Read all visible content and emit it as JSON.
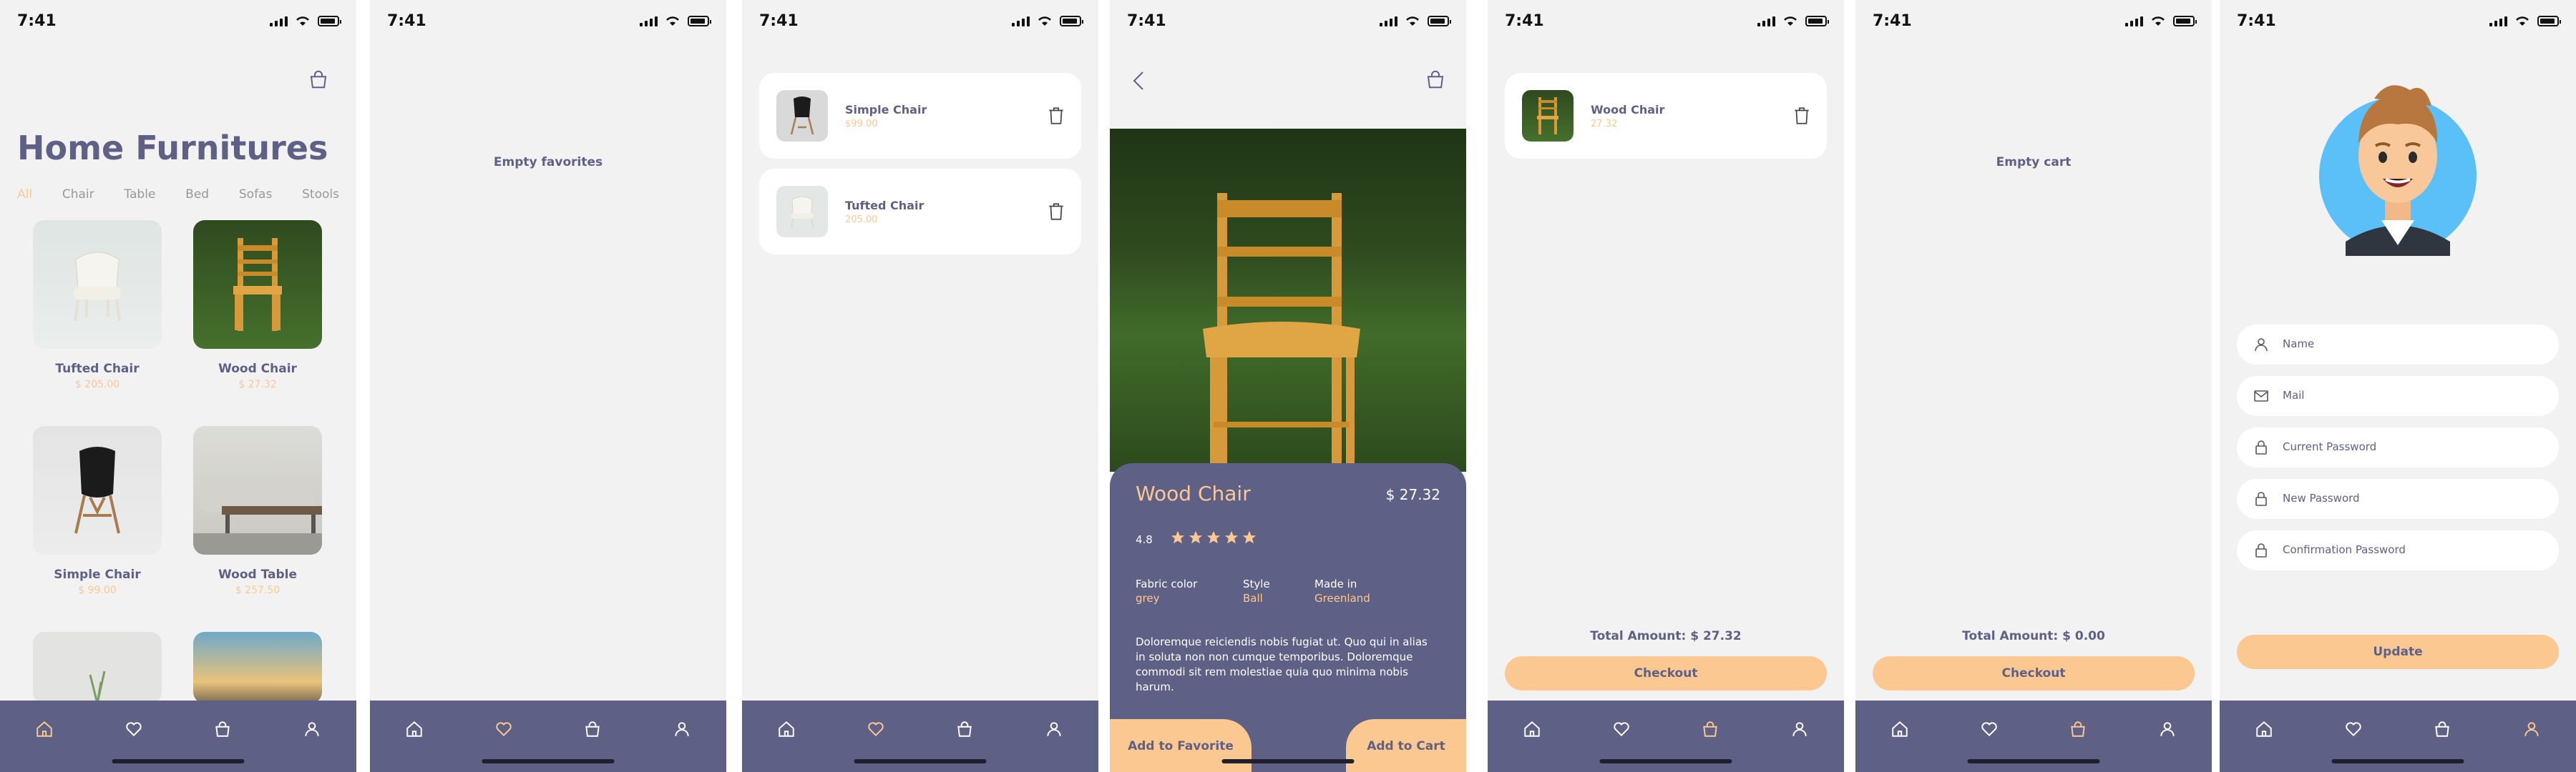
{
  "status_time": "7:41",
  "home": {
    "title": "Home Furnitures",
    "categories": [
      "All",
      "Chair",
      "Table",
      "Bed",
      "Sofas",
      "Stools"
    ],
    "products": [
      {
        "name": "Tufted Chair",
        "price": "$ 205.00"
      },
      {
        "name": "Wood Chair",
        "price": "$ 27.32"
      },
      {
        "name": "Simple Chair",
        "price": "$ 99.00"
      },
      {
        "name": "Wood Table",
        "price": "$ 257.50"
      }
    ]
  },
  "favorites_empty": {
    "message": "Empty favorites"
  },
  "favorites": {
    "items": [
      {
        "name": "Simple Chair",
        "price": "$99.00"
      },
      {
        "name": "Tufted Chair",
        "price": "205.00"
      }
    ]
  },
  "detail": {
    "name": "Wood Chair",
    "price": "$ 27.32",
    "rating": "4.8",
    "rating_value": 5,
    "attributes": [
      {
        "label": "Fabric color",
        "value": "grey"
      },
      {
        "label": "Style",
        "value": "Ball"
      },
      {
        "label": "Made in",
        "value": "Greenland"
      }
    ],
    "description": "Doloremque reiciendis nobis fugiat ut. Quo qui in alias in soluta non non cumque temporibus. Doloremque commodi sit rem molestiae quia quo minima nobis harum.",
    "add_favorite_label": "Add to Favorite",
    "add_cart_label": "Add to Cart"
  },
  "cart": {
    "items": [
      {
        "name": "Wood Chair",
        "price": "27.32"
      }
    ],
    "total": "Total Amount: $ 27.32",
    "checkout_label": "Checkout"
  },
  "cart_empty": {
    "message": "Empty cart",
    "total": "Total Amount: $ 0.00",
    "checkout_label": "Checkout"
  },
  "profile": {
    "fields": [
      {
        "placeholder": "Name",
        "icon": "user-icon"
      },
      {
        "placeholder": "Mail",
        "icon": "mail-icon"
      },
      {
        "placeholder": "Current Password",
        "icon": "lock-icon"
      },
      {
        "placeholder": "New Password",
        "icon": "lock-icon"
      },
      {
        "placeholder": "Confirmation Password",
        "icon": "lock-icon"
      }
    ],
    "update_label": "Update"
  },
  "colors": {
    "accent": "#fcc892",
    "primary": "#5f6085",
    "background": "#f2f2f2",
    "avatar_bg": "#5bc0f8"
  }
}
